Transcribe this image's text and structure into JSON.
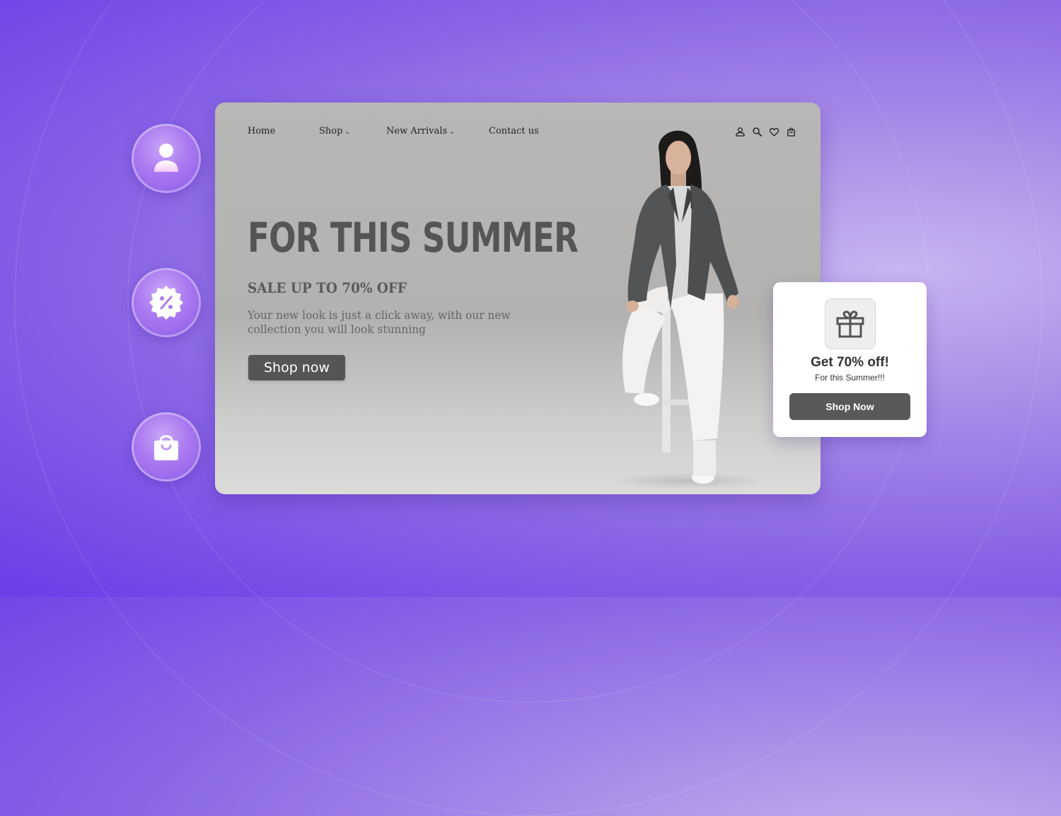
{
  "nav": {
    "items": [
      {
        "label": "Home"
      },
      {
        "label": "Shop"
      },
      {
        "label": "New Arrivals"
      },
      {
        "label": "Contact us"
      }
    ],
    "icons": [
      "user-icon",
      "search-icon",
      "heart-icon",
      "bag-icon"
    ]
  },
  "hero": {
    "title": "FOR THIS SUMMER",
    "subtitle": "SALE UP TO 70% OFF",
    "description": "Your new look is just a click away, with our new collection you will look stunning",
    "button_label": "Shop now"
  },
  "promo": {
    "icon": "gift-icon",
    "title": "Get 70% off!",
    "subtitle": "For this Summer!!!",
    "button_label": "Shop Now"
  },
  "side_icons": [
    "user-icon",
    "discount-badge-icon",
    "shopping-bag-icon"
  ],
  "colors": {
    "background_primary": "#6a3de8",
    "background_light": "#c8b4f0",
    "hero_text": "#555555",
    "button_dark": "#555555",
    "card_bg": "#b8b7b5"
  }
}
